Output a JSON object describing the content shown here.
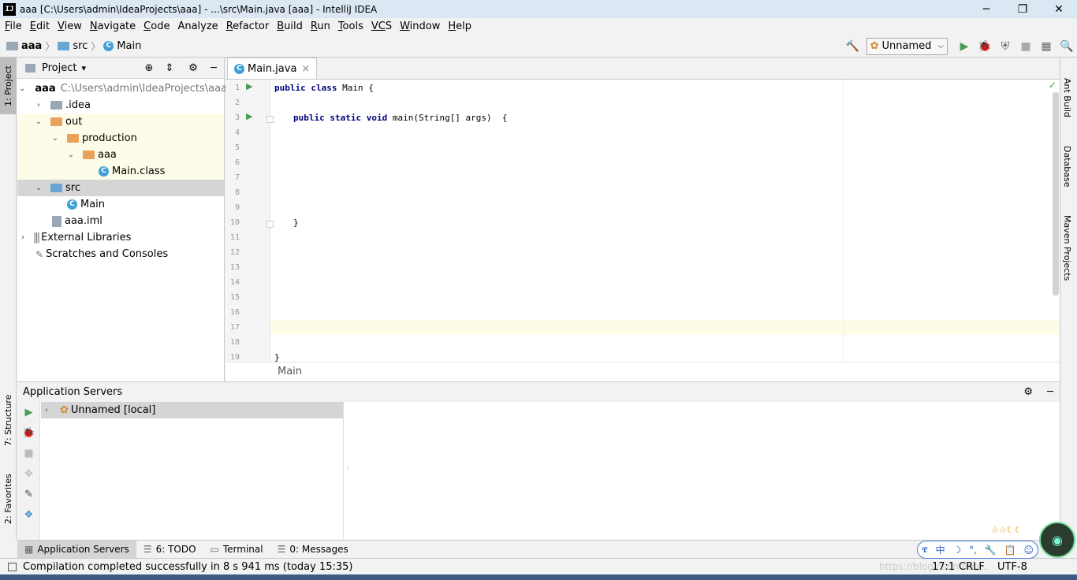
{
  "window": {
    "title": "aaa [C:\\Users\\admin\\IdeaProjects\\aaa] - ...\\src\\Main.java [aaa] - IntelliJ IDEA",
    "logo": "IJ",
    "minimize": "─",
    "restore": "❐",
    "close": "✕"
  },
  "menu": [
    {
      "mn": "F",
      "rest": "ile"
    },
    {
      "mn": "E",
      "rest": "dit"
    },
    {
      "mn": "V",
      "rest": "iew"
    },
    {
      "mn": "N",
      "rest": "avigate"
    },
    {
      "mn": "C",
      "rest": "ode"
    },
    {
      "mn": "",
      "rest": "Analyze"
    },
    {
      "mn": "R",
      "rest": "efactor"
    },
    {
      "mn": "B",
      "rest": "uild"
    },
    {
      "mn": "R",
      "rest": "un"
    },
    {
      "mn": "T",
      "rest": "ools"
    },
    {
      "mn": "VC",
      "rest": "S"
    },
    {
      "mn": "W",
      "rest": "indow"
    },
    {
      "mn": "H",
      "rest": "elp"
    }
  ],
  "breadcrumb": {
    "project": "aaa",
    "folder": "src",
    "file": "Main",
    "sep": "〉"
  },
  "toolbar": {
    "run_config": "Unnamed",
    "dropdown": "⌵",
    "hammer": "🔨",
    "run": "▶",
    "debug": "🐞",
    "coverage": "⛨",
    "stop": "■",
    "structure": "▦",
    "search": "🔍"
  },
  "left_tabs": {
    "project": "1: Project",
    "structure": "7: Structure",
    "favorites": "2: Favorites"
  },
  "right_tabs": {
    "ant": "Ant Build",
    "database": "Database",
    "maven": "Maven Projects"
  },
  "project_panel": {
    "title": "Project",
    "dropdown": "▾",
    "icons": {
      "target": "⊕",
      "collapse": "⇕",
      "gear": "⚙",
      "hide": "─"
    },
    "tree": [
      {
        "arrow": "⌄",
        "label": "aaa",
        "path": "C:\\Users\\admin\\IdeaProjects\\aaa",
        "icon": "folder"
      },
      {
        "arrow": "›",
        "label": ".idea",
        "icon": "folder"
      },
      {
        "arrow": "⌄",
        "label": "out",
        "icon": "folder"
      },
      {
        "arrow": "⌄",
        "label": "production",
        "icon": "folder"
      },
      {
        "arrow": "⌄",
        "label": "aaa",
        "icon": "folder"
      },
      {
        "arrow": "",
        "label": "Main.class",
        "icon": "class"
      },
      {
        "arrow": "⌄",
        "label": "src",
        "icon": "folder"
      },
      {
        "arrow": "",
        "label": "Main",
        "icon": "class"
      },
      {
        "arrow": "",
        "label": "aaa.iml",
        "icon": "file"
      },
      {
        "arrow": "›",
        "label": "External Libraries",
        "icon": "lib"
      },
      {
        "arrow": "",
        "label": "Scratches and Consoles",
        "icon": "scratch"
      }
    ]
  },
  "editor": {
    "tab": "Main.java",
    "tab_close": "×",
    "line_numbers": [
      "1",
      "2",
      "3",
      "4",
      "5",
      "6",
      "7",
      "8",
      "9",
      "10",
      "11",
      "12",
      "13",
      "14",
      "15",
      "16",
      "17",
      "18",
      "19"
    ],
    "lines": [
      {
        "n": 1,
        "kw": "public class",
        "rest": " Main {"
      },
      {
        "n": 3,
        "kw": "public static void",
        "rest": " main(String[] args)  {"
      },
      {
        "n": 10,
        "kw": "",
        "rest": "}"
      },
      {
        "n": 19,
        "kw": "",
        "rest": "}"
      }
    ],
    "breadcrumb": "Main",
    "check": "✓"
  },
  "app_servers": {
    "title": "Application Servers",
    "gear": "⚙",
    "hide": "─",
    "tools": [
      "▶",
      "🐞",
      "■",
      "✥",
      "✎",
      "❖"
    ],
    "items": [
      {
        "arrow": "›",
        "label": "Unnamed [local]"
      }
    ]
  },
  "bottom_tabs": [
    {
      "icon": "▦",
      "label": "Application Servers",
      "active": true
    },
    {
      "icon": "☰",
      "label": "6: TODO"
    },
    {
      "icon": "▭",
      "label": "Terminal"
    },
    {
      "icon": "☰",
      "label": "0: Messages"
    }
  ],
  "status": {
    "message": "Compilation completed successfully in 8 s 941 ms (today 15:35)",
    "position": "17:1",
    "line_sep": "CRLF",
    "encoding": "UTF-8",
    "watermark": "https://blog.csdn.net/..."
  },
  "ime": {
    "items": [
      "ዌ",
      "中",
      "☽",
      "°,",
      "🔧",
      "📋",
      "☺"
    ]
  },
  "stars": "☆☆☾☾"
}
